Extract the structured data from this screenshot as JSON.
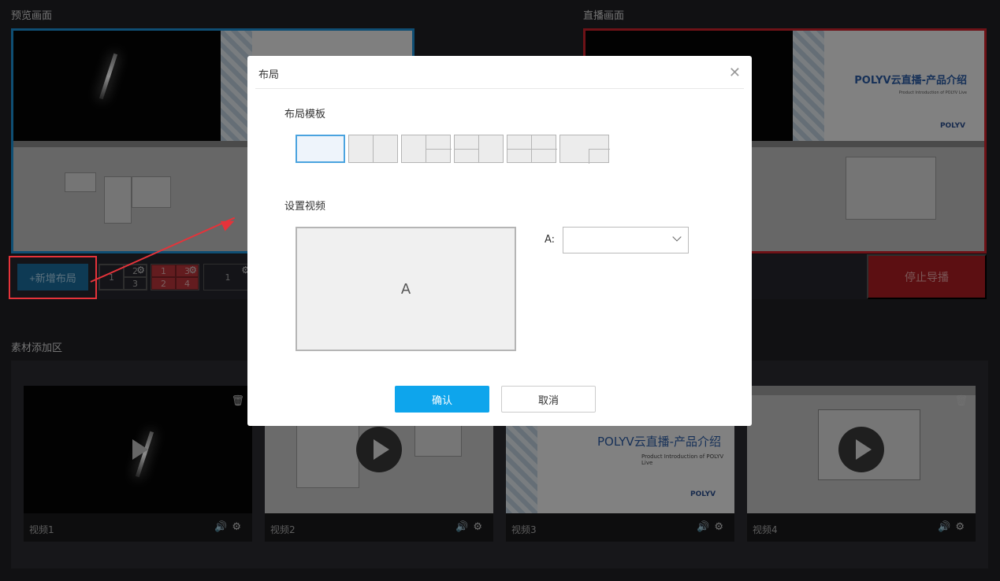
{
  "preview_label": "预览画面",
  "live_label": "直播画面",
  "material_label": "素材添加区",
  "add_layout_btn": "+新增布局",
  "stop_btn": "停止导播",
  "live_slide": {
    "title": "POLYV云直播-产品介绍",
    "subtitle": "Product Introduction of POLYV Live",
    "logo": "POLYV"
  },
  "layouts": [
    {
      "cells": [
        "1",
        "2",
        "3"
      ]
    },
    {
      "cells": [
        "1",
        "3",
        "2",
        "4"
      ]
    },
    {
      "cells": [
        "1"
      ]
    }
  ],
  "cards": [
    {
      "caption": "视频1"
    },
    {
      "caption": "视频2"
    },
    {
      "caption": "视频3",
      "slide_title": "POLYV云直播-产品介绍",
      "slide_sub": "Product Introduction of POLYV Live",
      "logo": "POLYV"
    },
    {
      "caption": "视频4"
    }
  ],
  "dialog": {
    "title": "布局",
    "template_label": "布局模板",
    "video_label": "设置视频",
    "area_label": "A",
    "select_label": "A:",
    "select_value": "",
    "confirm": "确认",
    "cancel": "取消"
  },
  "colors": {
    "accent": "#0ea5ec",
    "preview_border": "#1c8fd2",
    "live_border": "#c8222a",
    "highlight": "#e5333a"
  }
}
